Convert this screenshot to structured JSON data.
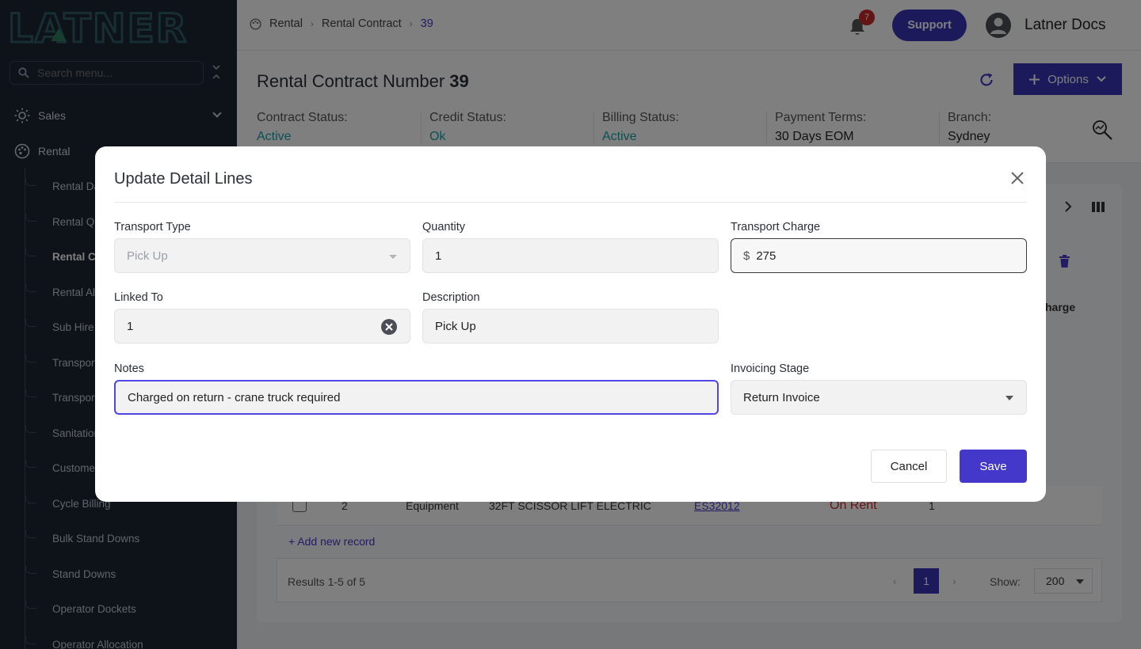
{
  "sidebar": {
    "logo": "LATNER",
    "search_placeholder": "Search menu...",
    "sections": [
      {
        "label": "Sales",
        "icon": "sun-icon"
      },
      {
        "label": "Rental",
        "icon": "palette-icon"
      }
    ],
    "items": [
      {
        "label": "Rental Da"
      },
      {
        "label": "Rental Qu"
      },
      {
        "label": "Rental Co"
      },
      {
        "label": "Rental All"
      },
      {
        "label": "Sub Hire"
      },
      {
        "label": "Transport"
      },
      {
        "label": "Transport"
      },
      {
        "label": "Sanitation"
      },
      {
        "label": "Customer"
      },
      {
        "label": "Cycle Billing"
      },
      {
        "label": "Bulk Stand Downs"
      },
      {
        "label": "Stand Downs"
      },
      {
        "label": "Operator Dockets"
      },
      {
        "label": "Operator Allocation"
      }
    ]
  },
  "topbar": {
    "breadcrumb": [
      "Rental",
      "Rental Contract",
      "39"
    ],
    "notifications": "7",
    "support_label": "Support",
    "user_name": "Latner Docs"
  },
  "page": {
    "title": "Rental Contract Number",
    "number": "39",
    "options_label": "Options",
    "statuses": [
      {
        "label": "Contract Status:",
        "value": "Active",
        "color": "#1aa0a8"
      },
      {
        "label": "Credit Status:",
        "value": "Ok",
        "color": "#1aa0a8"
      },
      {
        "label": "Billing Status:",
        "value": "Active",
        "color": "#1aa0a8"
      },
      {
        "label": "Payment Terms:",
        "value": "30 Days EOM"
      },
      {
        "label": "Branch:",
        "value": "Sydney"
      }
    ]
  },
  "background_table": {
    "row": {
      "no": "2",
      "type": "Equipment",
      "description": "32FT SCISSOR LIFT ELECTRIC",
      "code": "ES32012",
      "status": "On Rent",
      "qty": "1"
    },
    "add_record": "+ Add new record",
    "results": "Results 1-5 of 5",
    "page": "1",
    "show_label": "Show:",
    "show_value": "200",
    "header_partial": "harge"
  },
  "modal": {
    "title": "Update Detail Lines",
    "fields": {
      "transport_type": {
        "label": "Transport Type",
        "value": "Pick Up"
      },
      "quantity": {
        "label": "Quantity",
        "value": "1"
      },
      "transport_charge": {
        "label": "Transport Charge",
        "currency": "$",
        "value": "275"
      },
      "linked_to": {
        "label": "Linked To",
        "value": "1"
      },
      "description": {
        "label": "Description",
        "value": "Pick Up"
      },
      "notes": {
        "label": "Notes",
        "value": "Charged on return - crane truck required"
      },
      "invoicing_stage": {
        "label": "Invoicing Stage",
        "value": "Return Invoice"
      }
    },
    "cancel_label": "Cancel",
    "save_label": "Save"
  },
  "colors": {
    "accent": "#4338ca",
    "sidebar_bg": "#1c2633",
    "status_green": "#1aa0a8",
    "on_rent_red": "#c62828"
  }
}
